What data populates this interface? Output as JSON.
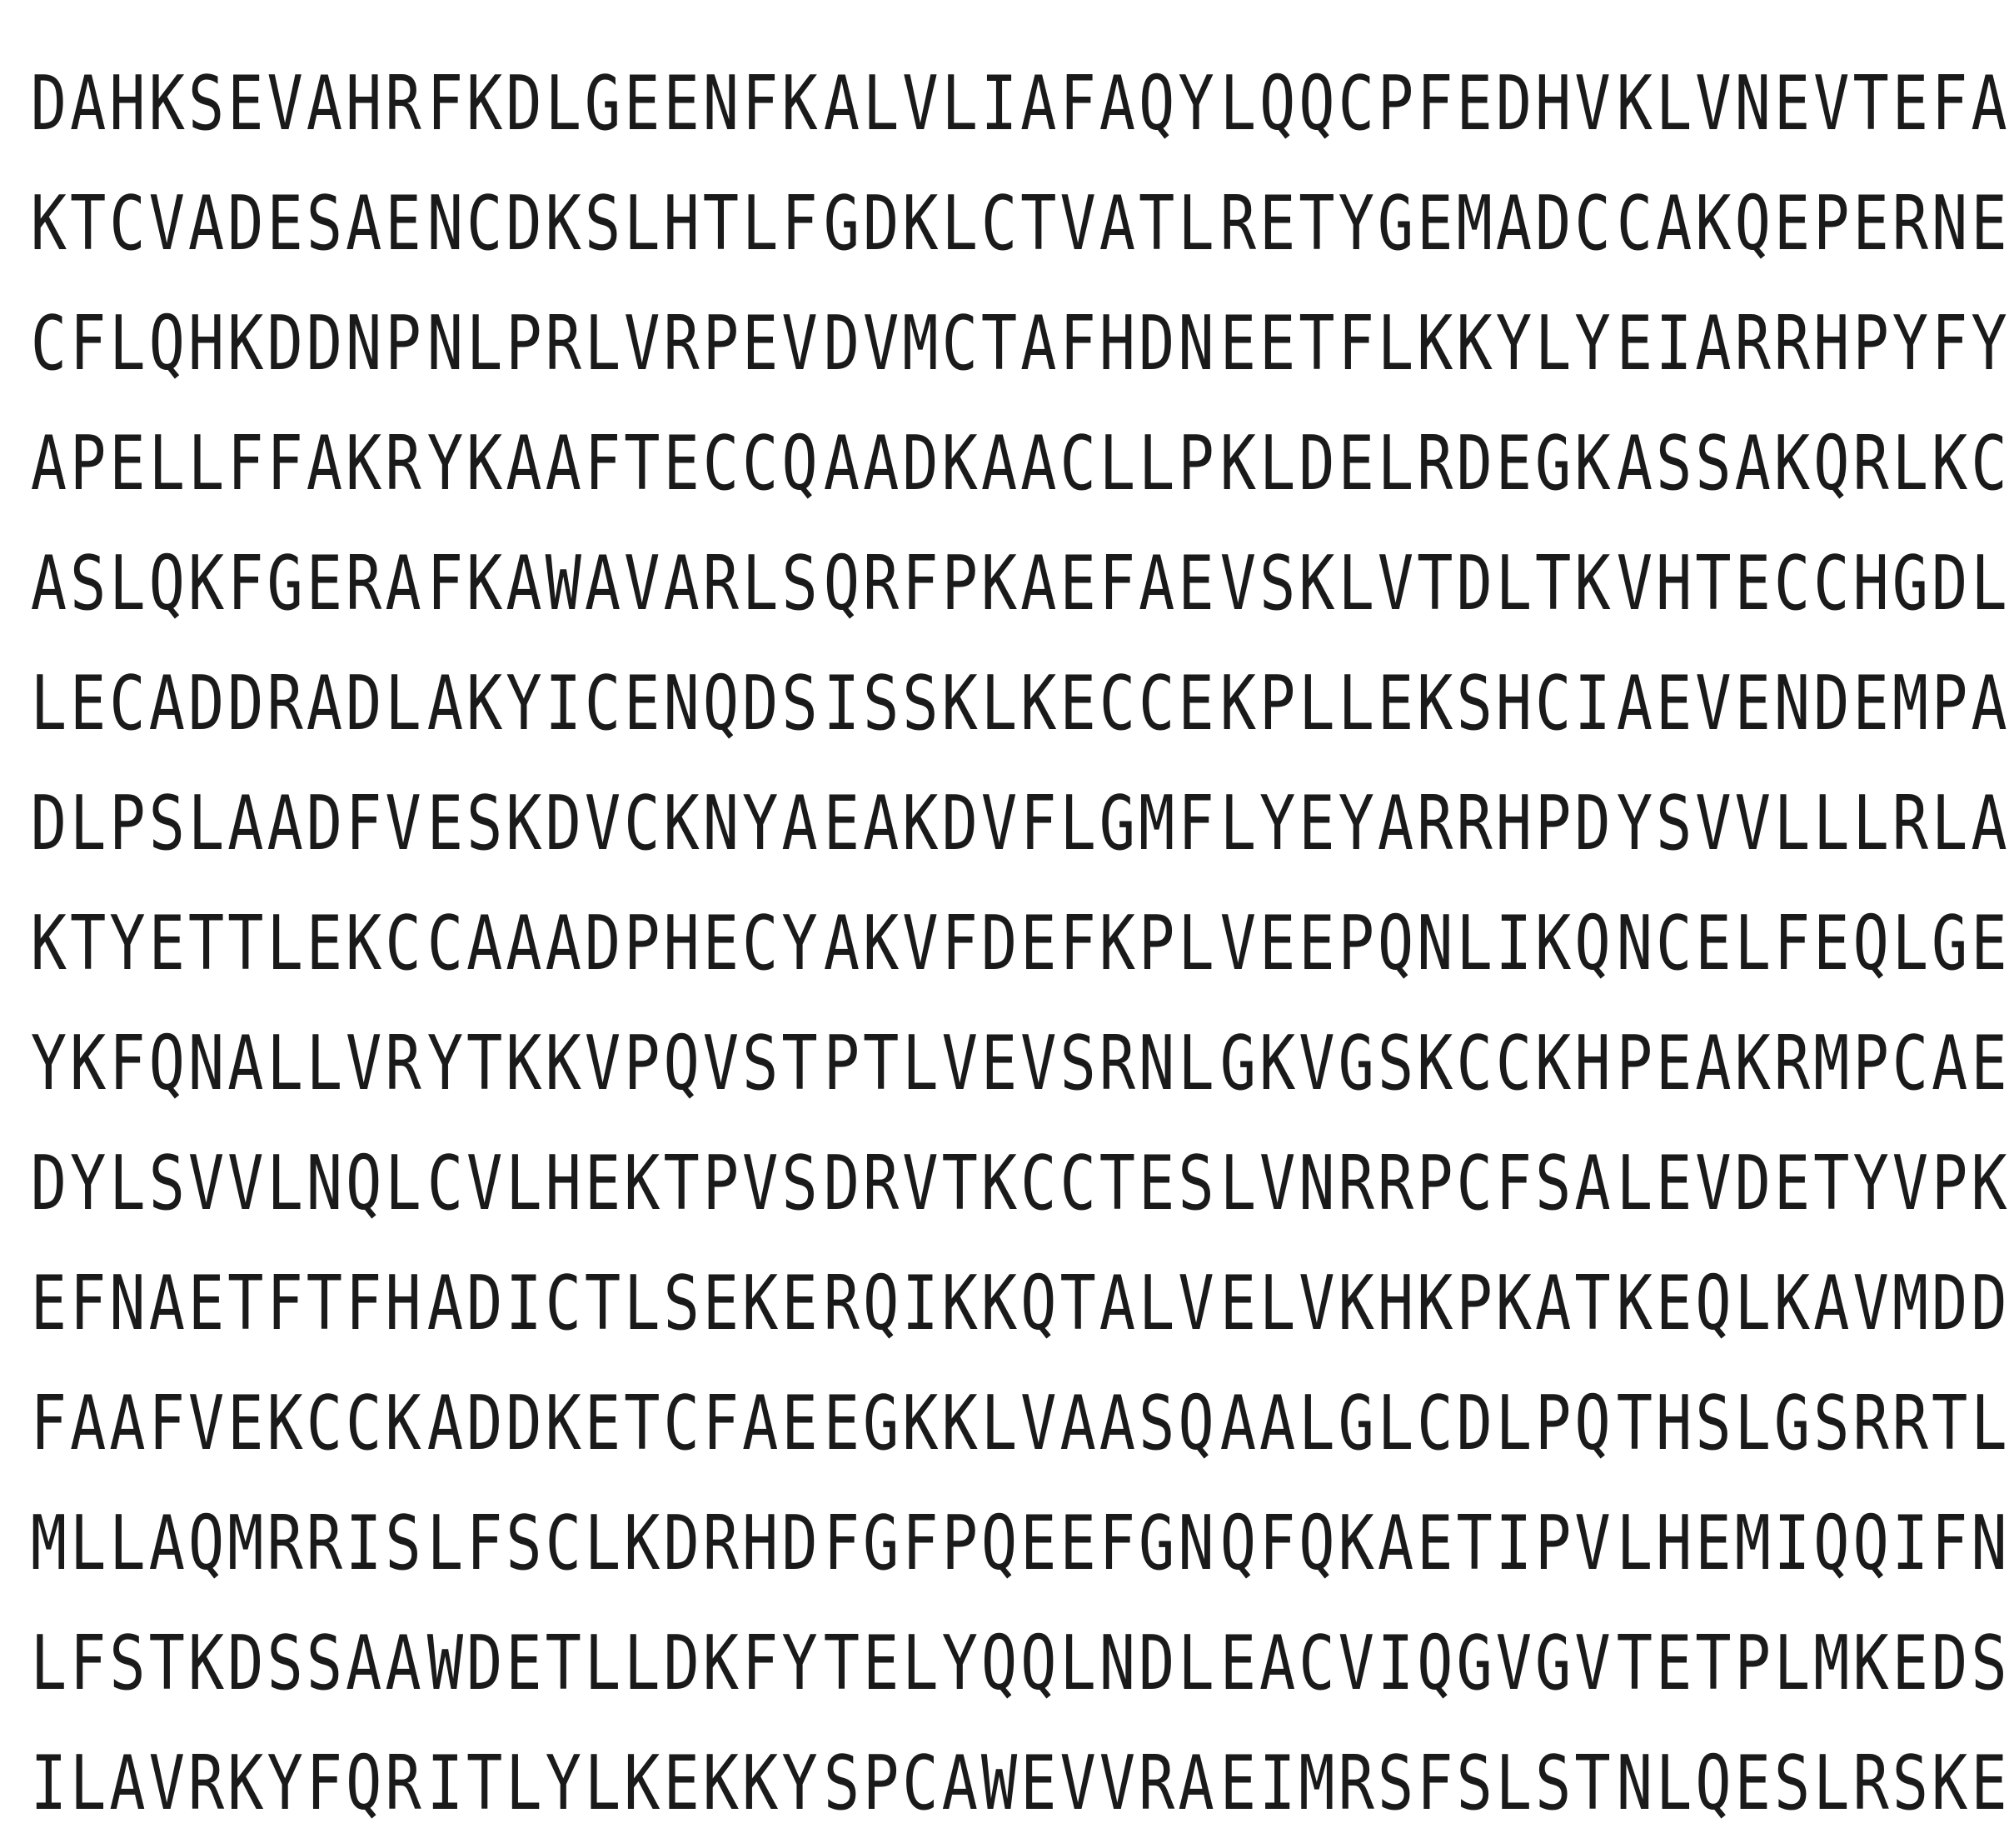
{
  "rows": [
    [
      "DAHKSEVAHR",
      "FKDLGEENFK",
      "ALVLIAFAQY",
      "LQQCPFEDHV",
      "KLVNEVTEFA"
    ],
    [
      "KTCVADESAE",
      "NCDKSLHTLF",
      "GDKLCTVATL",
      "RETYGEMADC",
      "CAKQEPERNE"
    ],
    [
      "CFLQHKDDNP",
      "NLPRLVRPEV",
      "DVMCTAFHDN",
      "EETFLKKYLY",
      "EIARRHPYFY"
    ],
    [
      "APELLFFAKR",
      "YKAAFTECCQ",
      "AADKAACLLP",
      "KLDELRDEGK",
      "ASSAKQRLKC"
    ],
    [
      "ASLQKFGERA",
      "FKAWAVARLS",
      "QRFPKAEFAE",
      "VSKLVTDLTK",
      "VHTECCHGDL"
    ],
    [
      "LECADDRADL",
      "AKYICENQDS",
      "ISSKLKECCE",
      "KPLLEKSHCI",
      "AEVENDEMPA"
    ],
    [
      "DLPSLAADFV",
      "ESKDVCKNYA",
      "EAKDVFLGMF",
      "LYEYARRHPD",
      "YSVVLLLRLA"
    ],
    [
      "KTYETTLEKC",
      "CAAADPHECY",
      "AKVFDEFKPL",
      "VEEPQNLIKQ",
      "NCELFEQLGE"
    ],
    [
      "YKFQNALLVR",
      "YTKKVPQVST",
      "PTLVEVSRNL",
      "GKVGSKCCKH",
      "PEAKRMPCAE"
    ],
    [
      "DYLSVVLNQL",
      "CVLHEKTPVS",
      "DRVTKCCTES",
      "LVNRRPCFSA",
      "LEVDETYVPK"
    ],
    [
      "EFNAETFTFH",
      "ADICTLSEKE",
      "RQIKKQTALV",
      "ELVKHKPKAT",
      "KEQLKAVMDD"
    ],
    [
      "FAAFVEKCCK",
      "ADDKETCFAE",
      "EGKKLVAASQ",
      "AALGLCDLPQ",
      "THSLGSRRTL"
    ],
    [
      "MLLAQMRRIS",
      "LFSCLKDRHD",
      "FGFPQEEFGN",
      "QFQKAETIPV",
      "LHEMIQQIFN"
    ],
    [
      "LFSTKDSSAA",
      "WDETLLDKFY",
      "TELYQQLNDL",
      "EACVIQGVGV",
      "TETPLMKEDS"
    ],
    [
      "ILAVRKYFQR",
      "ITLYLKEKKY",
      "SPCAWEVVRA",
      "EIMRSFSLST",
      "NLQESLRSKE"
    ]
  ]
}
